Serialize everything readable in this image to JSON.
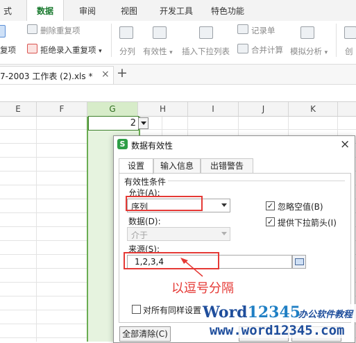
{
  "ribbon_tabs": [
    "式",
    "数据",
    "审阅",
    "视图",
    "开发工具",
    "特色功能"
  ],
  "ribbon": {
    "remove_duplicates": "删除重复项",
    "highlight_dup_partial": "复项",
    "reject_duplicates": "拒绝录入重复项",
    "split": "分列",
    "validity": "有效性",
    "insert_dropdown": "插入下拉列表",
    "record_form": "记录单",
    "consolidate": "合并计算",
    "simulation": "模拟分析",
    "create_partial": "创"
  },
  "doc_tab": {
    "title": "7-2003 工作表 (2).xls *",
    "close": "×",
    "add": "+"
  },
  "columns": [
    "E",
    "F",
    "G",
    "H",
    "I",
    "J",
    "K"
  ],
  "cell_value": "2",
  "dialog": {
    "title": "数据有效性",
    "close": "×",
    "tabs": [
      "设置",
      "输入信息",
      "出错警告"
    ],
    "section_title": "有效性条件",
    "allow_label": "允许(A):",
    "allow_value": "序列",
    "data_label": "数据(D):",
    "data_value": "介于",
    "ignore_blank": "忽略空值(B)",
    "ignore_blank_checked": true,
    "dropdown_arrow": "提供下拉箭头(I)",
    "dropdown_arrow_checked": true,
    "source_label": "来源(S):",
    "source_value": "1,2,3,4",
    "annotation": "以逗号分隔",
    "apply_all": "对所有同样设置",
    "clear_all": "全部清除(C)"
  },
  "watermark": {
    "brand_a": "Word",
    "brand_b": "12345",
    "tagline": "办公软件教程",
    "url": "www.word12345.com"
  },
  "colors": {
    "accent_green": "#1a7a2f",
    "selection_green": "#6aad52",
    "annotation_red": "#e53935",
    "watermark_blue": "#1f4e9c"
  }
}
